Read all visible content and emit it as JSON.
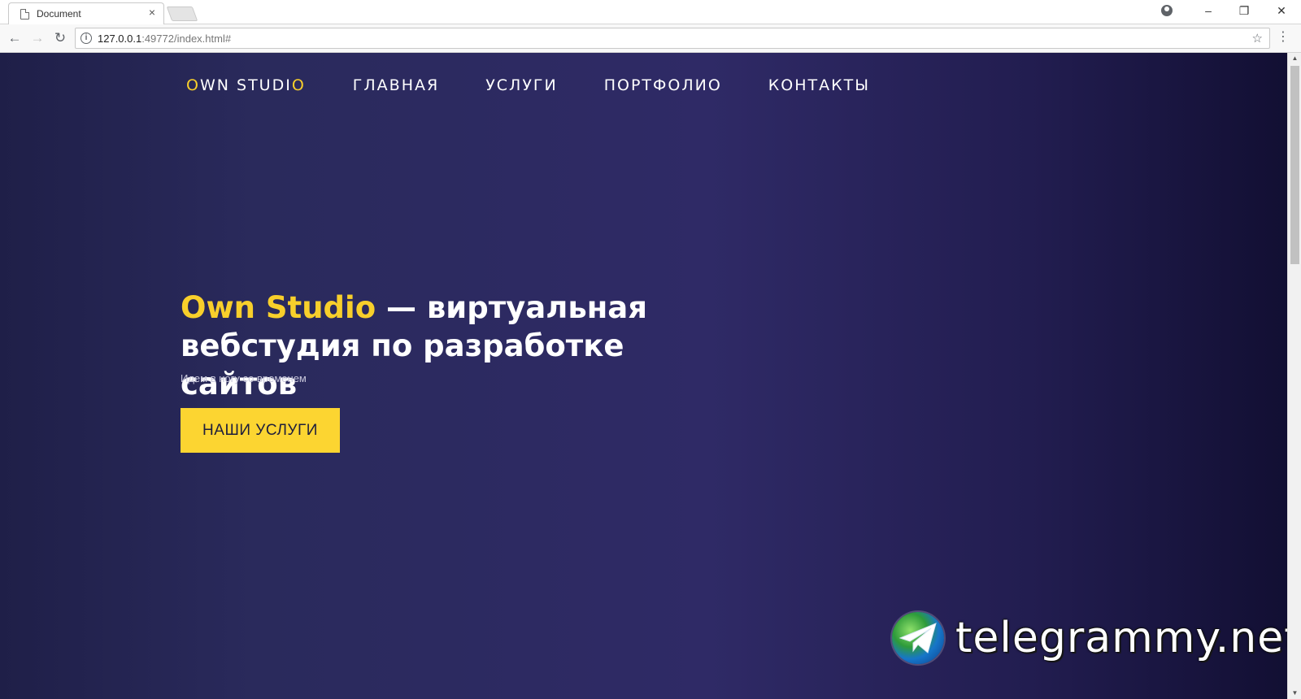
{
  "browser": {
    "tab_title": "Document",
    "tab_close": "×",
    "url_host": "127.0.0.1",
    "url_rest": ":49772/index.html#",
    "win_minimize": "–",
    "win_restore": "❐",
    "win_close": "✕"
  },
  "site": {
    "logo_first": "O",
    "logo_middle": "WN STUDI",
    "logo_last": "O",
    "nav": [
      "ГЛАВНАЯ",
      "УСЛУГИ",
      "ПОРТФОЛИО",
      "КОНТАКТЫ"
    ]
  },
  "hero": {
    "brand": "Own Studio",
    "title_rest": " — виртуальная вебстудия по разработке сайтов",
    "subtitle": "Идем в ногу со временем",
    "button": "НАШИ УСЛУГИ"
  },
  "watermark": {
    "text": "telegrammy.net"
  },
  "colors": {
    "accent": "#f8cf2b",
    "button_bg": "#fcd531",
    "bg_dark": "#1f1f48"
  }
}
